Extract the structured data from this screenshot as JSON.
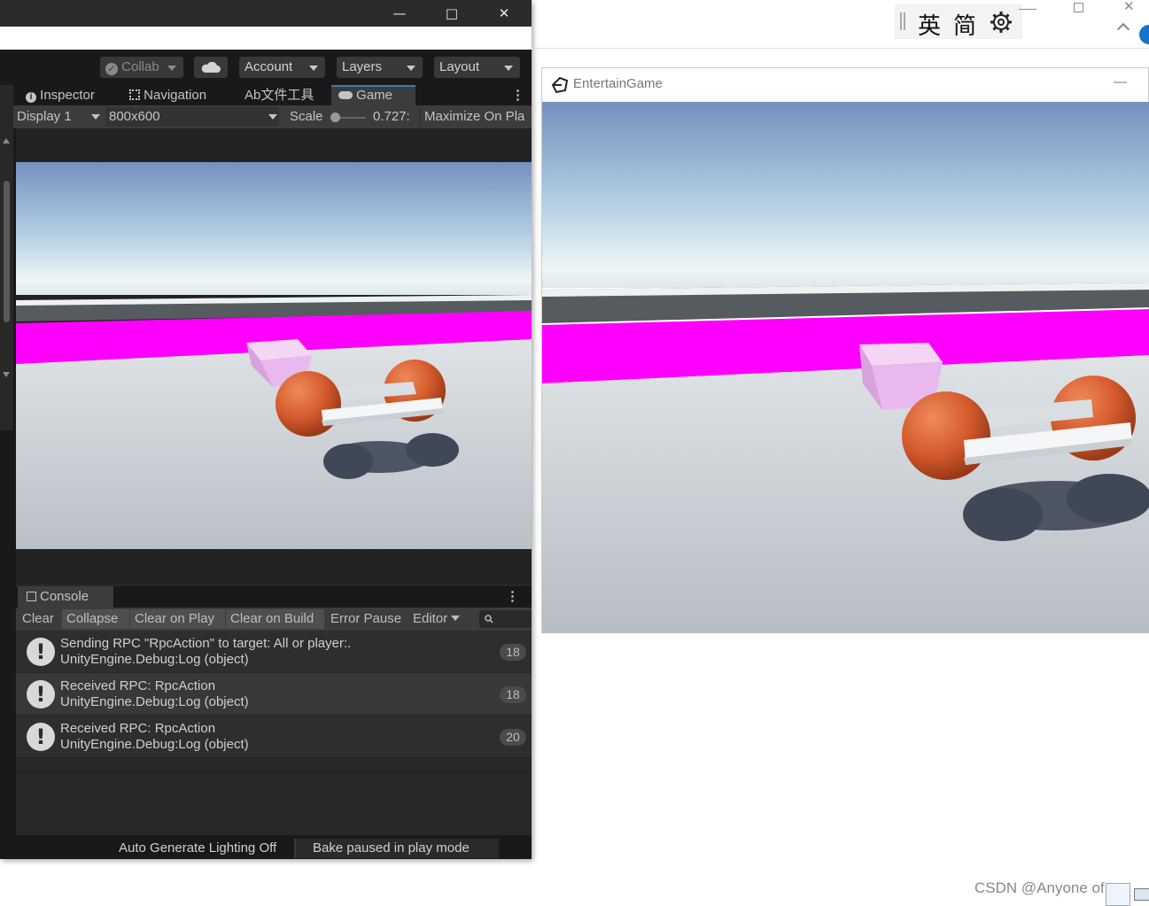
{
  "unity": {
    "toolbar": {
      "collab_label": "Collab",
      "account_label": "Account",
      "layers_label": "Layers",
      "layout_label": "Layout"
    },
    "tabs": [
      {
        "label": "Inspector"
      },
      {
        "label": "Navigation"
      },
      {
        "label": "Ab文件工具"
      },
      {
        "label": "Game"
      }
    ],
    "gamebar": {
      "display": "Display 1",
      "resolution": "800x600",
      "scale_label": "Scale",
      "scale_value": "0.727:",
      "maximize_label": "Maximize On Pla"
    },
    "console": {
      "tab_label": "Console",
      "buttons": [
        "Clear",
        "Collapse",
        "Clear on Play",
        "Clear on Build",
        "Error Pause",
        "Editor"
      ],
      "logs": [
        {
          "line1": "Sending RPC \"RpcAction\" to target: All or player:.",
          "line2": "UnityEngine.Debug:Log (object)",
          "count": "18"
        },
        {
          "line1": "Received RPC: RpcAction",
          "line2": "UnityEngine.Debug:Log (object)",
          "count": "18"
        },
        {
          "line1": "Received RPC: RpcAction",
          "line2": "UnityEngine.Debug:Log (object)",
          "count": "20"
        }
      ]
    },
    "status": {
      "lighting": "Auto Generate Lighting Off",
      "bake": "Bake paused in play mode"
    }
  },
  "game_window": {
    "title": "EntertainGame"
  },
  "ime": {
    "mode_char": "英",
    "script_char": "简"
  },
  "watermark": "CSDN @Anyone of us",
  "colors": {
    "editor_bg": "#191919",
    "panel_bg": "#282828",
    "active_tab_accent": "#3a79bb",
    "pink_strip": "#ff00ff",
    "sphere": "#d45a2c"
  }
}
